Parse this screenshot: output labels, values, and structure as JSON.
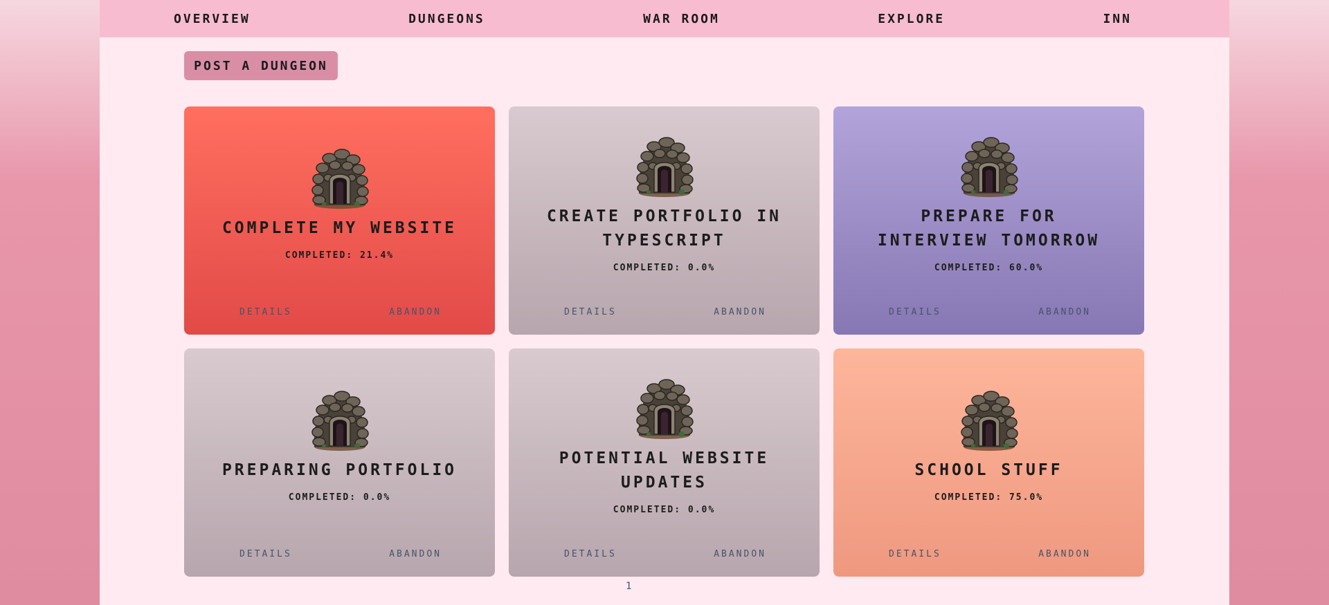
{
  "nav": {
    "items": [
      "OVERVIEW",
      "DUNGEONS",
      "WAR ROOM",
      "EXPLORE",
      "INN"
    ]
  },
  "post_button": "POST A DUNGEON",
  "card_actions": {
    "details": "DETAILS",
    "abandon": "ABANDON"
  },
  "dungeons": [
    {
      "title": "COMPLETE MY WEBSITE",
      "completed": "COMPLETED: 21.4%",
      "progress": 21.4,
      "color_top": "#ff6f5f",
      "color_bottom": "#e24a48"
    },
    {
      "title": "CREATE PORTFOLIO IN TYPESCRIPT",
      "completed": "COMPLETED: 0.0%",
      "progress": 0.0,
      "color_top": "#d8cacf",
      "color_bottom": "#b7a6ad"
    },
    {
      "title": "PREPARE FOR INTERVIEW TOMORROW",
      "completed": "COMPLETED: 60.0%",
      "progress": 60.0,
      "color_top": "#b2a4da",
      "color_bottom": "#8777b3"
    },
    {
      "title": "PREPARING PORTFOLIO",
      "completed": "COMPLETED: 0.0%",
      "progress": 0.0,
      "color_top": "#d8cacf",
      "color_bottom": "#b7a6ad"
    },
    {
      "title": "POTENTIAL WEBSITE UPDATES",
      "completed": "COMPLETED: 0.0%",
      "progress": 0.0,
      "color_top": "#d8cacf",
      "color_bottom": "#b7a6ad"
    },
    {
      "title": "SCHOOL STUFF",
      "completed": "COMPLETED: 75.0%",
      "progress": 75.0,
      "color_top": "#fdb69b",
      "color_bottom": "#ef9880"
    }
  ],
  "pagination": {
    "current": "1"
  }
}
